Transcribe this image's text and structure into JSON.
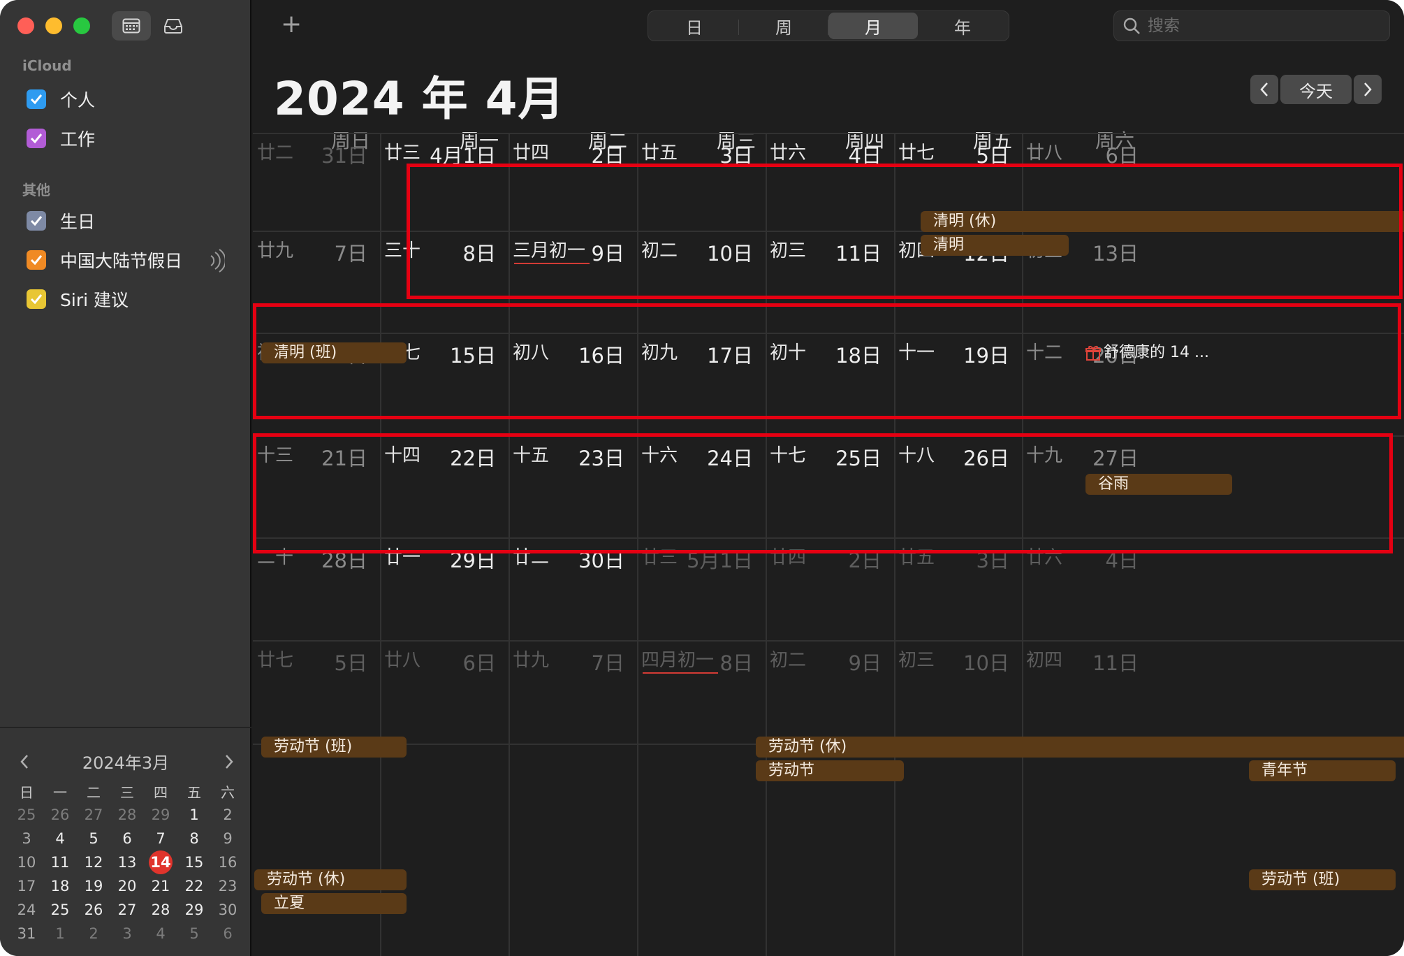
{
  "sidebar": {
    "section_icloud": "iCloud",
    "section_other": "其他",
    "calendars": [
      {
        "label": "个人",
        "color": "#2e9bf0"
      },
      {
        "label": "工作",
        "color": "#b25cd6"
      }
    ],
    "other_calendars": [
      {
        "label": "生日",
        "color": "#7e8aa5"
      },
      {
        "label": "中国大陆节假日",
        "color": "#f08a24"
      },
      {
        "label": "Siri 建议",
        "color": "#e8c634"
      }
    ]
  },
  "mini_calendar": {
    "title": "2024年3月",
    "weekdays": [
      "日",
      "一",
      "二",
      "三",
      "四",
      "五",
      "六"
    ],
    "weeks": [
      [
        "25",
        "26",
        "27",
        "28",
        "29",
        "1",
        "2"
      ],
      [
        "3",
        "4",
        "5",
        "6",
        "7",
        "8",
        "9"
      ],
      [
        "10",
        "11",
        "12",
        "13",
        "14",
        "15",
        "16"
      ],
      [
        "17",
        "18",
        "19",
        "20",
        "21",
        "22",
        "23"
      ],
      [
        "24",
        "25",
        "26",
        "27",
        "28",
        "29",
        "30"
      ],
      [
        "31",
        "1",
        "2",
        "3",
        "4",
        "5",
        "6"
      ]
    ],
    "today": "14"
  },
  "toolbar": {
    "add_label": "+",
    "views": [
      "日",
      "周",
      "月",
      "年"
    ],
    "active_view": "月",
    "search_placeholder": "搜索"
  },
  "header": {
    "month_title": "2024 年 4月",
    "today_label": "今天"
  },
  "weekday_headers": [
    "周日",
    "周一",
    "周二",
    "周三",
    "周四",
    "周五",
    "周六"
  ],
  "weeks": [
    [
      {
        "lunar": "廿二",
        "date": "31日"
      },
      {
        "lunar": "廿三",
        "date": "4月1日"
      },
      {
        "lunar": "廿四",
        "date": "2日"
      },
      {
        "lunar": "廿五",
        "date": "3日"
      },
      {
        "lunar": "廿六",
        "date": "4日"
      },
      {
        "lunar": "廿七",
        "date": "5日"
      },
      {
        "lunar": "廿八",
        "date": "6日"
      }
    ],
    [
      {
        "lunar": "廿九",
        "date": "7日"
      },
      {
        "lunar": "三十",
        "date": "8日"
      },
      {
        "lunar": "三月初一",
        "date": "9日"
      },
      {
        "lunar": "初二",
        "date": "10日"
      },
      {
        "lunar": "初三",
        "date": "11日"
      },
      {
        "lunar": "初四",
        "date": "12日"
      },
      {
        "lunar": "初五",
        "date": "13日"
      }
    ],
    [
      {
        "lunar": "初六",
        "date": "14日"
      },
      {
        "lunar": "初七",
        "date": "15日"
      },
      {
        "lunar": "初八",
        "date": "16日"
      },
      {
        "lunar": "初九",
        "date": "17日"
      },
      {
        "lunar": "初十",
        "date": "18日"
      },
      {
        "lunar": "十一",
        "date": "19日"
      },
      {
        "lunar": "十二",
        "date": "20日"
      }
    ],
    [
      {
        "lunar": "十三",
        "date": "21日"
      },
      {
        "lunar": "十四",
        "date": "22日"
      },
      {
        "lunar": "十五",
        "date": "23日"
      },
      {
        "lunar": "十六",
        "date": "24日"
      },
      {
        "lunar": "十七",
        "date": "25日"
      },
      {
        "lunar": "十八",
        "date": "26日"
      },
      {
        "lunar": "十九",
        "date": "27日"
      }
    ],
    [
      {
        "lunar": "二十",
        "date": "28日"
      },
      {
        "lunar": "廿一",
        "date": "29日"
      },
      {
        "lunar": "廿二",
        "date": "30日"
      },
      {
        "lunar": "廿三",
        "date": "5月1日"
      },
      {
        "lunar": "廿四",
        "date": "2日"
      },
      {
        "lunar": "廿五",
        "date": "3日"
      },
      {
        "lunar": "廿六",
        "date": "4日"
      }
    ],
    [
      {
        "lunar": "廿七",
        "date": "5日"
      },
      {
        "lunar": "廿八",
        "date": "6日"
      },
      {
        "lunar": "廿九",
        "date": "7日"
      },
      {
        "lunar": "四月初一",
        "date": "8日"
      },
      {
        "lunar": "初二",
        "date": "9日"
      },
      {
        "lunar": "初三",
        "date": "10日"
      },
      {
        "lunar": "初四",
        "date": "11日"
      }
    ]
  ],
  "events": {
    "qingming_rest": "清明 (休)",
    "qingming": "清明",
    "qingming_work": "清明 (班)",
    "birthday": "舒德康的 14 ...",
    "guyu": "谷雨",
    "labor_work_1": "劳动节 (班)",
    "labor_rest_1": "劳动节 (休)",
    "labor_day": "劳动节",
    "youth_day": "青年节",
    "labor_rest_2": "劳动节 (休)",
    "lixia": "立夏",
    "labor_work_2": "劳动节 (班)"
  },
  "colors": {
    "holiday_event": "#5a3a17",
    "highlight_box": "#e60012",
    "today_circle": "#e0342c"
  }
}
